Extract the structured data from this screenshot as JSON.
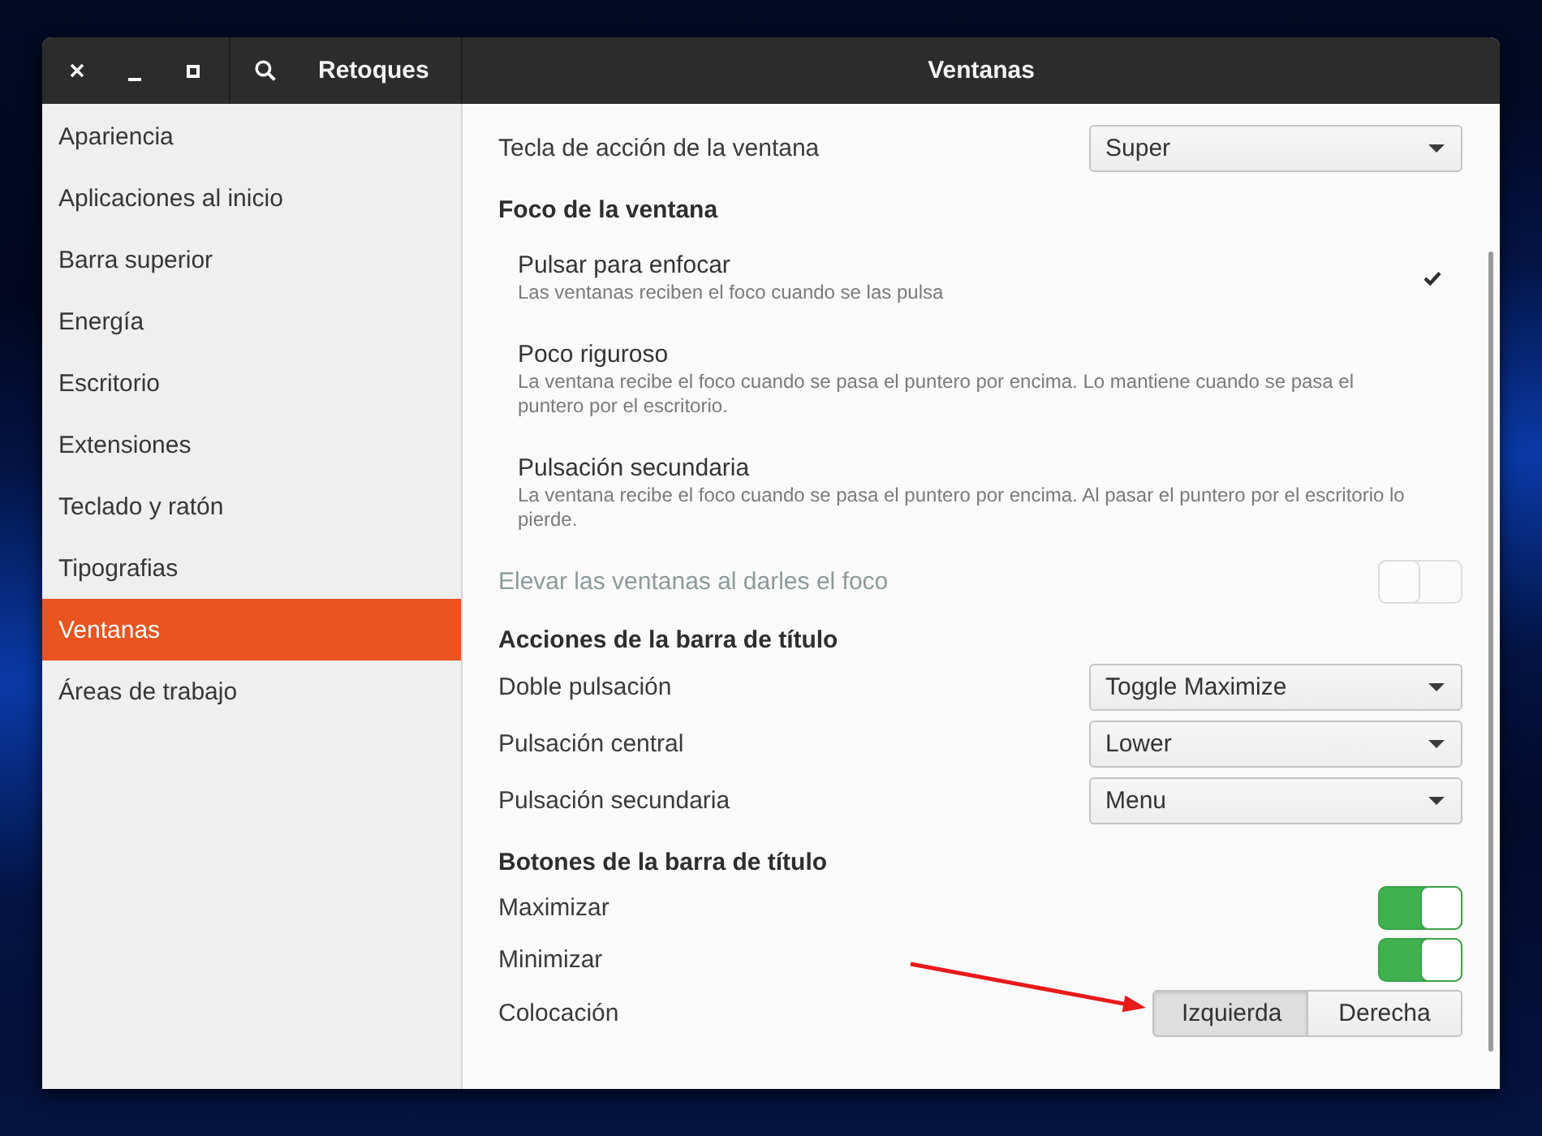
{
  "window": {
    "app_title": "Retoques",
    "page_title": "Ventanas"
  },
  "sidebar": {
    "items": [
      {
        "label": "Apariencia",
        "selected": false
      },
      {
        "label": "Aplicaciones al inicio",
        "selected": false
      },
      {
        "label": "Barra superior",
        "selected": false
      },
      {
        "label": "Energía",
        "selected": false
      },
      {
        "label": "Escritorio",
        "selected": false
      },
      {
        "label": "Extensiones",
        "selected": false
      },
      {
        "label": "Teclado y ratón",
        "selected": false
      },
      {
        "label": "Tipografias",
        "selected": false
      },
      {
        "label": "Ventanas",
        "selected": true
      },
      {
        "label": "Áreas de trabajo",
        "selected": false
      }
    ]
  },
  "action_key": {
    "label": "Tecla de acción de la ventana",
    "value": "Super"
  },
  "focus": {
    "heading": "Foco de la ventana",
    "modes": [
      {
        "label": "Pulsar para enfocar",
        "description": "Las ventanas reciben el foco cuando se las pulsa",
        "selected": true
      },
      {
        "label": "Poco riguroso",
        "description": "La ventana recibe el foco cuando se pasa el puntero por encima. Lo mantiene cuando se pasa el puntero por el escritorio.",
        "selected": false
      },
      {
        "label": "Pulsación secundaria",
        "description": "La ventana recibe el foco cuando se pasa el puntero por encima. Al pasar el puntero por el escritorio lo pierde.",
        "selected": false
      }
    ],
    "raise": {
      "label": "Elevar las ventanas al darles el foco",
      "on": false,
      "disabled": true
    }
  },
  "titlebar_actions": {
    "heading": "Acciones de la barra de título",
    "rows": [
      {
        "label": "Doble pulsación",
        "value": "Toggle Maximize"
      },
      {
        "label": "Pulsación central",
        "value": "Lower"
      },
      {
        "label": "Pulsación secundaria",
        "value": "Menu"
      }
    ]
  },
  "titlebar_buttons": {
    "heading": "Botones de la barra de título",
    "switches": [
      {
        "label": "Maximizar",
        "on": true
      },
      {
        "label": "Minimizar",
        "on": true
      }
    ],
    "placement": {
      "label": "Colocación",
      "options": [
        {
          "label": "Izquierda",
          "selected": true
        },
        {
          "label": "Derecha",
          "selected": false
        }
      ]
    }
  }
}
